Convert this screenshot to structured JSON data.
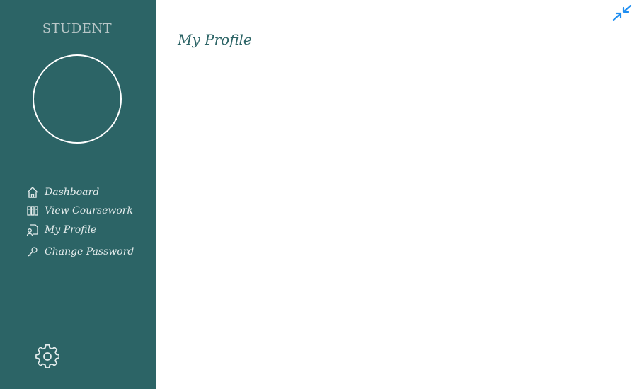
{
  "sidebar": {
    "role_title": "STUDENT",
    "items": [
      {
        "label": "Dashboard",
        "icon": "home-icon"
      },
      {
        "label": "View Coursework",
        "icon": "coursework-icon"
      },
      {
        "label": "My Profile",
        "icon": "profile-icon"
      },
      {
        "label": "Change Password",
        "icon": "key-icon"
      }
    ],
    "settings_icon": "gear-icon"
  },
  "main": {
    "title": "My Profile",
    "collapse_icon": "collapse-arrows-icon"
  },
  "colors": {
    "sidebar_bg": "#2c6466",
    "accent_blue": "#1f8ef1",
    "title_color": "#2c6466"
  }
}
